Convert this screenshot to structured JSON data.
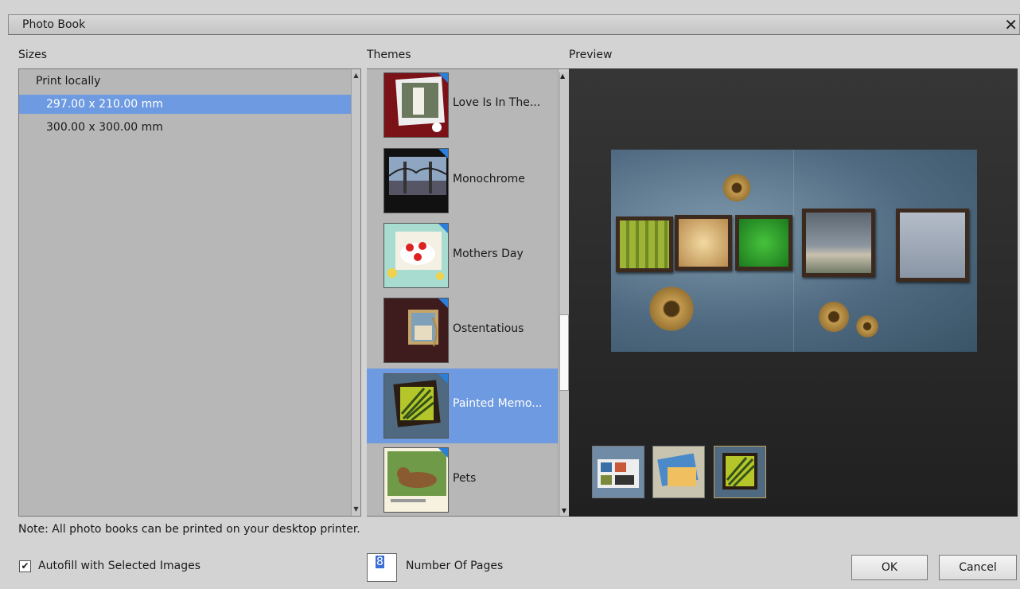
{
  "window": {
    "title": "Photo Book",
    "close_glyph": "✕"
  },
  "labels": {
    "sizes": "Sizes",
    "themes": "Themes",
    "preview": "Preview"
  },
  "sizes": {
    "group": "Print locally",
    "items": [
      {
        "label": "297.00 x 210.00 mm",
        "selected": true
      },
      {
        "label": "300.00 x 300.00 mm",
        "selected": false
      }
    ]
  },
  "themes": [
    {
      "name": "Love Is In The...",
      "selected": false
    },
    {
      "name": "Monochrome",
      "selected": false
    },
    {
      "name": "Mothers Day",
      "selected": false
    },
    {
      "name": "Ostentatious",
      "selected": false
    },
    {
      "name": "Painted Memo...",
      "selected": true
    },
    {
      "name": "Pets",
      "selected": false
    }
  ],
  "note": "Note: All photo books can be printed on your desktop printer.",
  "autofill": {
    "label": "Autofill with Selected Images",
    "checked": true,
    "check_glyph": "✔"
  },
  "pages": {
    "value": "8",
    "label": "Number Of Pages"
  },
  "buttons": {
    "ok": "OK",
    "cancel": "Cancel"
  },
  "colors": {
    "selection": "#6d9ae0",
    "preview_bg": "#2a2a2a",
    "badge": "#2b7fd8"
  }
}
